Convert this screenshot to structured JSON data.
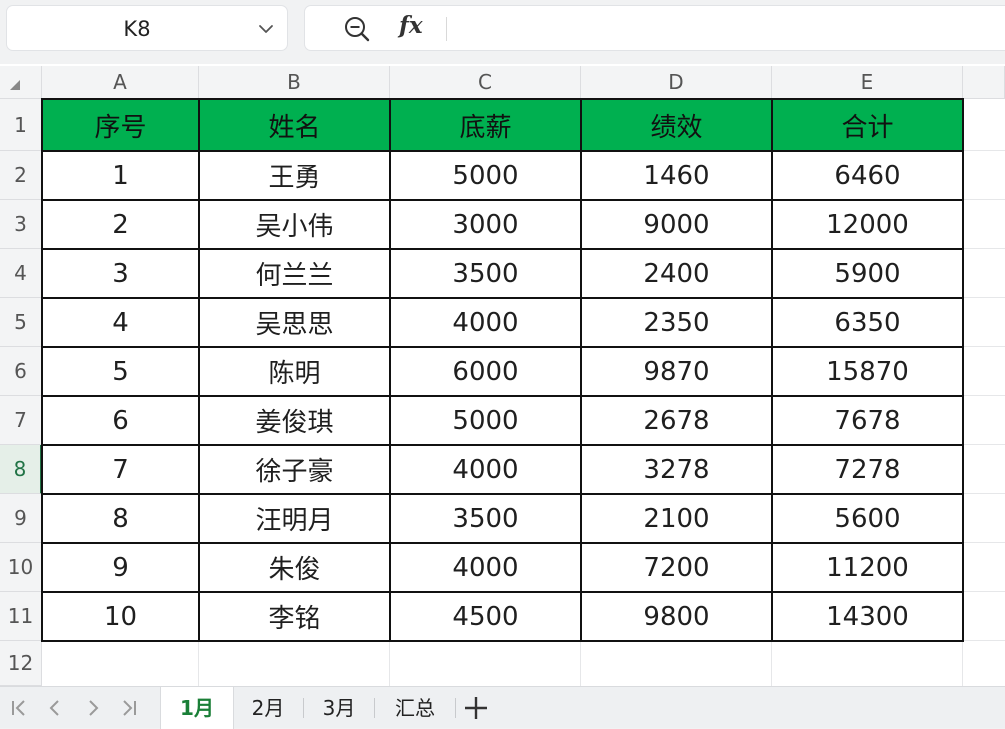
{
  "toolbar": {
    "name_box": "K8",
    "zoom_icon": "zoom-out-icon",
    "fx_label": "fx",
    "formula": ""
  },
  "columns": [
    "A",
    "B",
    "C",
    "D",
    "E"
  ],
  "rows": [
    "1",
    "2",
    "3",
    "4",
    "5",
    "6",
    "7",
    "8",
    "9",
    "10",
    "11",
    "12"
  ],
  "active_row": "8",
  "table": {
    "header": [
      "序号",
      "姓名",
      "底薪",
      "绩效",
      "合计"
    ],
    "header_color": "#00b050",
    "data": [
      [
        "1",
        "王勇",
        "5000",
        "1460",
        "6460"
      ],
      [
        "2",
        "吴小伟",
        "3000",
        "9000",
        "12000"
      ],
      [
        "3",
        "何兰兰",
        "3500",
        "2400",
        "5900"
      ],
      [
        "4",
        "吴思思",
        "4000",
        "2350",
        "6350"
      ],
      [
        "5",
        "陈明",
        "6000",
        "9870",
        "15870"
      ],
      [
        "6",
        "姜俊琪",
        "5000",
        "2678",
        "7678"
      ],
      [
        "7",
        "徐子豪",
        "4000",
        "3278",
        "7278"
      ],
      [
        "8",
        "汪明月",
        "3500",
        "2100",
        "5600"
      ],
      [
        "9",
        "朱俊",
        "4000",
        "7200",
        "11200"
      ],
      [
        "10",
        "李铭",
        "4500",
        "9800",
        "14300"
      ]
    ]
  },
  "sheet_tabs": [
    "1月",
    "2月",
    "3月",
    "汇总"
  ],
  "active_tab": "1月",
  "accent_color": "#1a7f37"
}
